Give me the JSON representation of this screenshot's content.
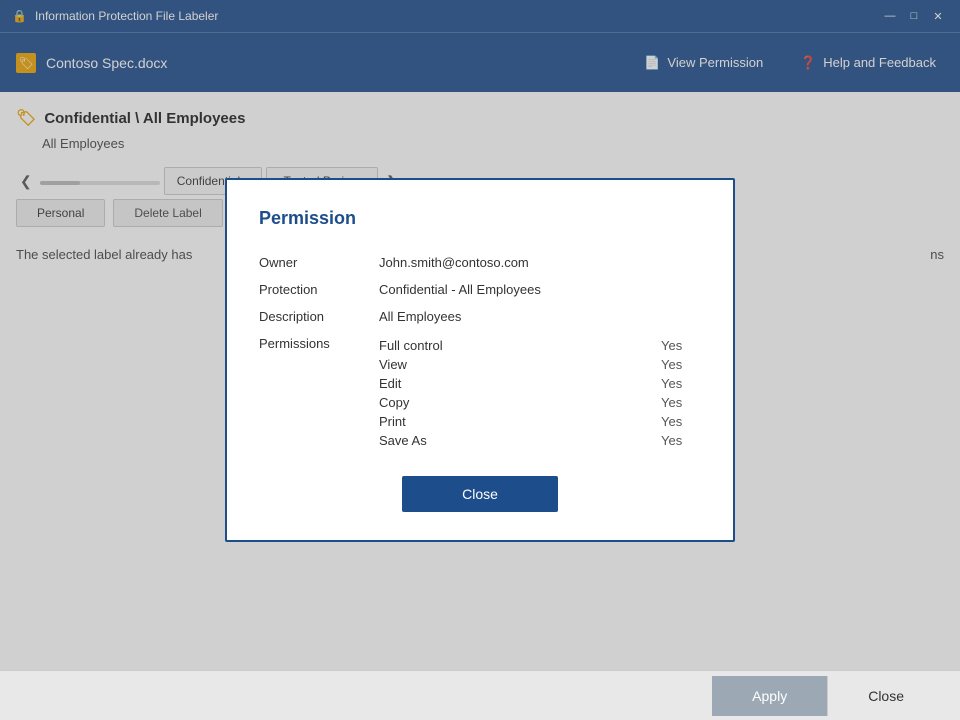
{
  "titleBar": {
    "title": "Information Protection File Labeler",
    "controls": {
      "minimize": "—",
      "maximize": "□",
      "close": "✕"
    }
  },
  "header": {
    "fileIcon": "🏷",
    "fileName": "Contoso Spec.docx",
    "viewPermissionLabel": "View Permission",
    "helpFeedbackLabel": "Help and Feedback"
  },
  "main": {
    "labelTitle": "Confidential \\ All Employees",
    "labelSubtitle": "All Employees",
    "tabs": {
      "prevArrow": "❮",
      "nextArrow": "❯",
      "items": [
        {
          "label": "Confidential ▾"
        },
        {
          "label": "Tented Proje..."
        }
      ]
    },
    "buttons": {
      "personal": "Personal",
      "deleteLabel": "Delete Label"
    },
    "infoText": "The selected label already has",
    "infoTextRight": "ns"
  },
  "footer": {
    "applyLabel": "Apply",
    "closeLabel": "Close"
  },
  "dialog": {
    "title": "Permission",
    "fields": {
      "owner": {
        "label": "Owner",
        "value": "John.smith@contoso.com"
      },
      "protection": {
        "label": "Protection",
        "value": "Confidential - All Employees"
      },
      "description": {
        "label": "Description",
        "value": "All Employees"
      },
      "permissions": {
        "label": "Permissions",
        "items": [
          {
            "name": "Full control",
            "value": "Yes"
          },
          {
            "name": "View",
            "value": "Yes"
          },
          {
            "name": "Edit",
            "value": "Yes"
          },
          {
            "name": "Copy",
            "value": "Yes"
          },
          {
            "name": "Print",
            "value": "Yes"
          },
          {
            "name": "Save As",
            "value": "Yes"
          }
        ]
      }
    },
    "closeButton": "Close"
  }
}
